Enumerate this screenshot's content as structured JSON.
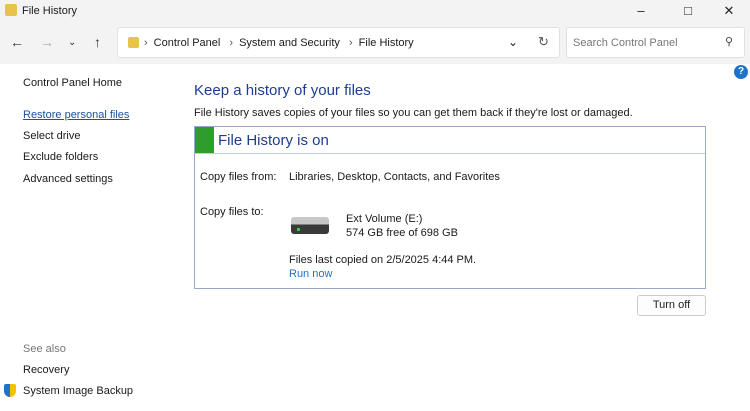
{
  "window": {
    "title": "File History"
  },
  "nav": {
    "breadcrumbs": [
      "Control Panel",
      "System and Security",
      "File History"
    ],
    "search_placeholder": "Search Control Panel"
  },
  "sidebar": {
    "home": "Control Panel Home",
    "items": [
      "Restore personal files",
      "Select drive",
      "Exclude folders",
      "Advanced settings"
    ],
    "see_also": "See also",
    "see_also_items": [
      "Recovery",
      "System Image Backup"
    ]
  },
  "main": {
    "heading": "Keep a history of your files",
    "description": "File History saves copies of your files so you can get them back if they're lost or damaged.",
    "status": "File History is on",
    "copy_from_label": "Copy files from:",
    "copy_from_value": "Libraries, Desktop, Contacts, and Favorites",
    "copy_to_label": "Copy files to:",
    "drive_name": "Ext Volume (E:)",
    "drive_space": "574 GB free of 698 GB",
    "last_copied": "Files last copied on 2/5/2025 4:44 PM.",
    "run_now": "Run now",
    "turn_off": "Turn off"
  },
  "colors": {
    "status_green": "#2e9d2e",
    "heading_blue": "#1e3d8f"
  }
}
